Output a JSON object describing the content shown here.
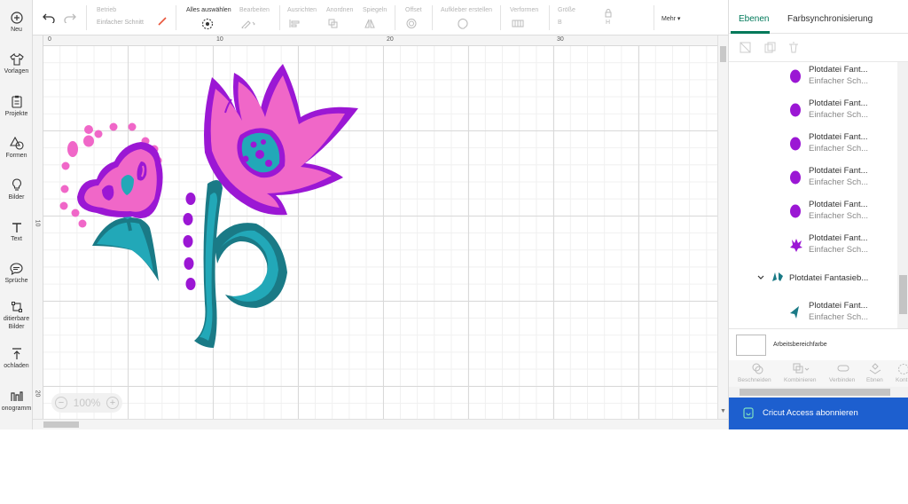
{
  "sidebar": {
    "items": [
      {
        "label": "Neu",
        "icon": "plus-circle-icon"
      },
      {
        "label": "Vorlagen",
        "icon": "shirt-icon"
      },
      {
        "label": "Projekte",
        "icon": "clipboard-icon"
      },
      {
        "label": "Formen",
        "icon": "shapes-icon"
      },
      {
        "label": "Bilder",
        "icon": "lightbulb-icon"
      },
      {
        "label": "Text",
        "icon": "text-icon"
      },
      {
        "label": "Sprüche",
        "icon": "speech-icon"
      },
      {
        "label": "ditierbare",
        "label2": "Bilder",
        "icon": "editable-images-icon"
      },
      {
        "label": "ochladen",
        "icon": "upload-icon"
      },
      {
        "label": "onogramm",
        "icon": "monogram-icon"
      }
    ]
  },
  "toolbar": {
    "operation_label": "Betrieb",
    "operation_value": "Einfacher Schnitt",
    "select_all": "Alles auswählen",
    "edit": "Bearbeiten",
    "align": "Ausrichten",
    "arrange": "Anordnen",
    "mirror": "Spiegeln",
    "offset": "Offset",
    "add_strip": "Aufkleber erstellen",
    "distribute": "Verformen",
    "size": "Größe",
    "size_w": "B",
    "size_h": "H",
    "more": "Mehr"
  },
  "rulers": {
    "top": [
      "0",
      "10",
      "20",
      "30"
    ],
    "left": [
      "10",
      "20"
    ]
  },
  "zoom": {
    "level": "100%"
  },
  "panel": {
    "tabs": [
      {
        "label": "Ebenen",
        "active": true
      },
      {
        "label": "Farbsynchronisierung",
        "active": false
      }
    ],
    "layers": [
      {
        "name": "Plotdatei Fant...",
        "op": "Einfacher Sch...",
        "color": "#9b17d4",
        "shape": "blob"
      },
      {
        "name": "Plotdatei Fant...",
        "op": "Einfacher Sch...",
        "color": "#9b17d4",
        "shape": "blob"
      },
      {
        "name": "Plotdatei Fant...",
        "op": "Einfacher Sch...",
        "color": "#9b17d4",
        "shape": "blob"
      },
      {
        "name": "Plotdatei Fant...",
        "op": "Einfacher Sch...",
        "color": "#9b17d4",
        "shape": "blob"
      },
      {
        "name": "Plotdatei Fant...",
        "op": "Einfacher Sch...",
        "color": "#9b17d4",
        "shape": "blob"
      },
      {
        "name": "Plotdatei Fant...",
        "op": "Einfacher Sch...",
        "color": "#9b17d4",
        "shape": "flower"
      }
    ],
    "group": {
      "name": "Plotdatei Fantasieb..."
    },
    "group_child": {
      "name": "Plotdatei Fant...",
      "op": "Einfacher Sch...",
      "color": "#1a7a86"
    },
    "artboard_color_label": "Arbeitsbereichfarbe",
    "bottom_tools": [
      "Beschneiden",
      "Kombinieren",
      "Verbinden",
      "Ebnen",
      "Kont"
    ],
    "subscribe": "Cricut Access abonnieren"
  },
  "colors": {
    "accent": "#00795a",
    "subscribe_bg": "#1d5fcf",
    "pink": "#f067c8",
    "purple": "#9b17d4",
    "teal": "#22a8b8",
    "dark_teal": "#1a7a86"
  }
}
